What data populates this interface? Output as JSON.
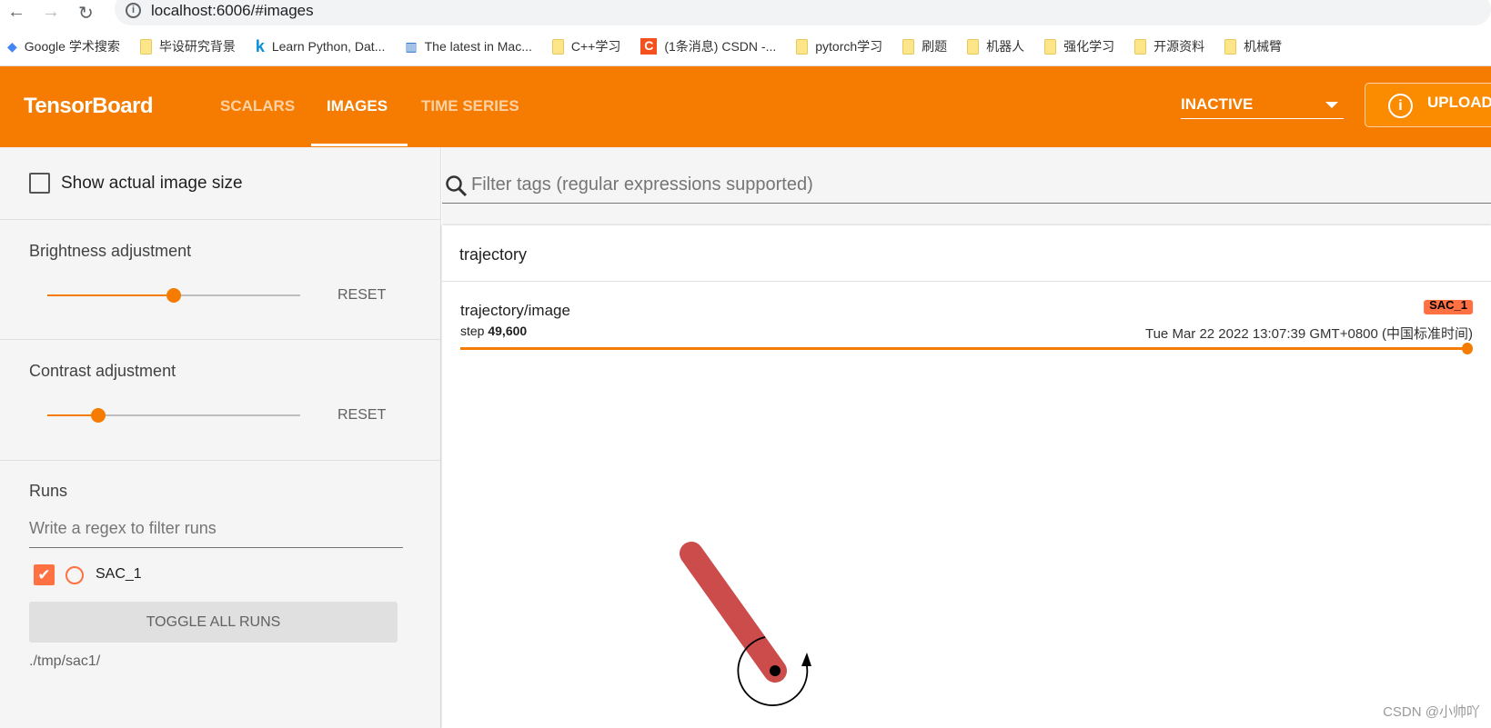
{
  "browser": {
    "url": "localhost:6006/#images",
    "bookmarks": [
      "Google 学术搜索",
      "毕设研究背景",
      "Learn Python, Dat...",
      "The latest in Mac...",
      "C++学习",
      "(1条消息) CSDN -...",
      "pytorch学习",
      "刷题",
      "机器人",
      "强化学习",
      "开源资料",
      "机械臂"
    ]
  },
  "header": {
    "logo": "TensorBoard",
    "tabs": [
      "SCALARS",
      "IMAGES",
      "TIME SERIES"
    ],
    "active_tab": "IMAGES",
    "run_select": "INACTIVE",
    "upload": "UPLOAD",
    "accent": "#f57c00"
  },
  "sidebar": {
    "show_actual_size": "Show actual image size",
    "brightness": {
      "label": "Brightness adjustment",
      "reset": "RESET",
      "value": 0.5
    },
    "contrast": {
      "label": "Contrast adjustment",
      "reset": "RESET",
      "value": 0.2
    },
    "runs": {
      "title": "Runs",
      "filter_placeholder": "Write a regex to filter runs",
      "items": [
        {
          "name": "SAC_1",
          "checked": true,
          "color": "#ff7043"
        }
      ],
      "toggle": "TOGGLE ALL RUNS",
      "logdir": "./tmp/sac1/"
    }
  },
  "main": {
    "filter_placeholder": "Filter tags (regular expressions supported)",
    "card_title": "trajectory",
    "image": {
      "tag": "trajectory/image",
      "run": "SAC_1",
      "step_label": "step",
      "step": "49,600",
      "time": "Tue Mar 22 2022 13:07:39 GMT+0800 (中国标准时间)",
      "step_slider_value": 1.0
    }
  },
  "watermark": "CSDN @小帅吖"
}
